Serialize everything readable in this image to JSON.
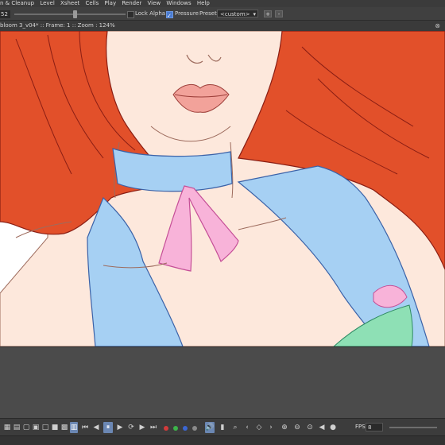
{
  "menubar": {
    "items": [
      "n & Cleanup",
      "Level",
      "Xsheet",
      "Cells",
      "Play",
      "Render",
      "View",
      "Windows",
      "Help"
    ]
  },
  "tool_options": {
    "size_value": "52",
    "lock_alpha_label": "Lock Alpha",
    "lock_alpha_checked": false,
    "pressure_label": "Pressure",
    "pressure_checked": true,
    "preset_label": "Preset:",
    "preset_value": "<custom>",
    "add_preset": "+",
    "remove_preset": "-"
  },
  "viewer_info": {
    "text": "bloom 3_v04* :: Frame: 1 :: Zoom : 124%",
    "close_glyph": "⊗"
  },
  "playback": {
    "fps_label": "FPS",
    "fps_value": "8",
    "buttons": [
      "first-frame",
      "prev-key",
      "pause",
      "play",
      "loop",
      "next-key",
      "last-frame"
    ],
    "channel_colors": {
      "red": "#d23b3b",
      "green": "#3cb44a",
      "blue": "#3b66d2",
      "alpha": "#8a8a8a"
    }
  },
  "colors": {
    "hair": "#e2502a",
    "hair_line": "#8a1e14",
    "skin": "#fde8dc",
    "skin_line": "#9d6b5d",
    "lips": "#f2a29a",
    "collar": "#a6d0f3",
    "collar_line": "#3b62a8",
    "ribbon": "#f8b3d9",
    "ribbon_line": "#c54f97",
    "green_cloth": "#8ee0b5"
  }
}
